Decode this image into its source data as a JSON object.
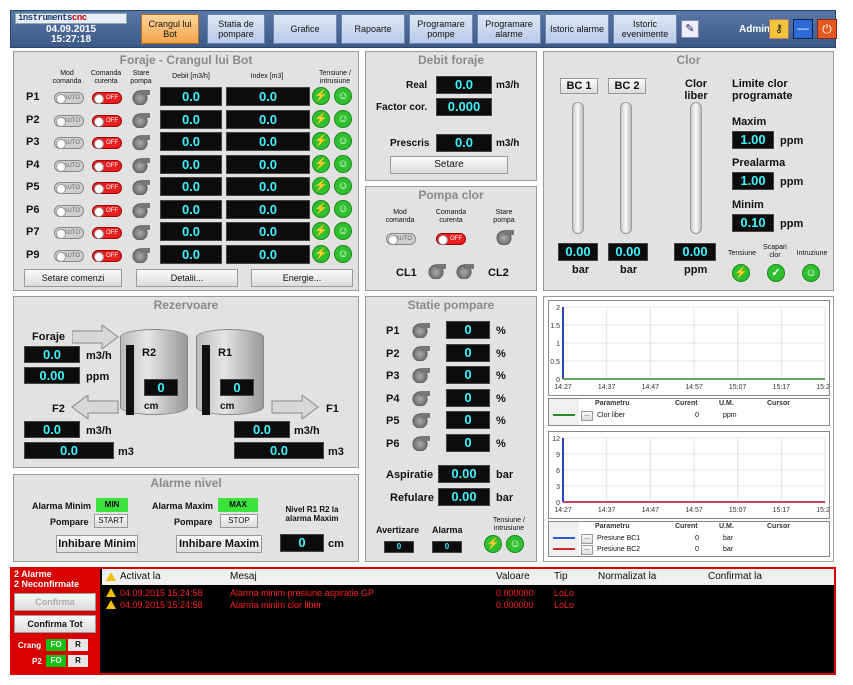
{
  "topbar": {
    "logo_a": "instruments",
    "logo_b": "cnc",
    "date": "04.09.2015",
    "time": "15:27:18",
    "user": "Admin",
    "nav": [
      "Crangul lui Bot",
      "Statia de pompare",
      "Grafice",
      "Rapoarte",
      "Programare pompe",
      "Programare alarme",
      "Istoric alarme",
      "Istoric evenimente"
    ]
  },
  "foraje": {
    "title": "Foraje - Crangul lui Bot",
    "h_mod": "Mod comanda",
    "h_cmd": "Comanda curenta",
    "h_stare": "Stare pompa",
    "h_debit": "Debit [m3/h]",
    "h_index": "Index [m3]",
    "h_tens": "Tensiune / intrusiune",
    "rows": [
      {
        "id": "P1",
        "mode": "AUTO",
        "cmd": "OFF",
        "debit": "0.0",
        "index": "0.0"
      },
      {
        "id": "P2",
        "mode": "AUTO",
        "cmd": "OFF",
        "debit": "0.0",
        "index": "0.0"
      },
      {
        "id": "P3",
        "mode": "AUTO",
        "cmd": "OFF",
        "debit": "0.0",
        "index": "0.0"
      },
      {
        "id": "P4",
        "mode": "AUTO",
        "cmd": "OFF",
        "debit": "0.0",
        "index": "0.0"
      },
      {
        "id": "P5",
        "mode": "AUTO",
        "cmd": "OFF",
        "debit": "0.0",
        "index": "0.0"
      },
      {
        "id": "P6",
        "mode": "AUTO",
        "cmd": "OFF",
        "debit": "0.0",
        "index": "0.0"
      },
      {
        "id": "P7",
        "mode": "AUTO",
        "cmd": "OFF",
        "debit": "0.0",
        "index": "0.0"
      },
      {
        "id": "P9",
        "mode": "AUTO",
        "cmd": "OFF",
        "debit": "0.0",
        "index": "0.0"
      }
    ],
    "btn_setare": "Setare comenzi",
    "btn_detalii": "Detalii...",
    "btn_energie": "Energie..."
  },
  "debit": {
    "title": "Debit foraje",
    "real_label": "Real",
    "real": "0.0",
    "real_unit": "m3/h",
    "factor_label": "Factor cor.",
    "factor": "0.000",
    "prescris_label": "Prescris",
    "prescris": "0.0",
    "prescris_unit": "m3/h",
    "btn": "Setare"
  },
  "pompa_clor": {
    "title": "Pompa clor",
    "h_mod": "Mod comanda",
    "h_cmd": "Comanda curenta",
    "h_stare": "Stare pompa",
    "mode": "AUTO",
    "cmd": "OFF",
    "cl1": "CL1",
    "cl2": "CL2"
  },
  "clor": {
    "title": "Clor",
    "bc1": "BC 1",
    "bc2": "BC 2",
    "liber": "Clor liber",
    "bc1_val": "0.00",
    "bc2_val": "0.00",
    "liber_val": "0.00",
    "unit_bar": "bar",
    "unit_ppm": "ppm",
    "lim_title": "Limite clor programate",
    "maxim_label": "Maxim",
    "maxim": "1.00",
    "prealarma_label": "Prealarma",
    "prealarma": "1.00",
    "minim_label": "Minim",
    "minim": "0.10",
    "tens": "Tensiune",
    "scapari": "Scapari clor",
    "intruz": "Intruziune"
  },
  "rezervoare": {
    "title": "Rezervoare",
    "foraje": "Foraje",
    "foraje_flow": "0.0",
    "flow_unit": "m3/h",
    "foraje_ppm": "0.00",
    "ppm": "ppm",
    "r2": "R2",
    "r1": "R1",
    "r2_val": "0",
    "r1_val": "0",
    "cm": "cm",
    "f2": "F2",
    "f1": "F1",
    "f2_flow": "0.0",
    "f2_vol": "0.0",
    "f1_flow": "0.0",
    "f1_vol": "0.0",
    "m3": "m3"
  },
  "alarme_nivel": {
    "title": "Alarme nivel",
    "min_label": "Alarma Minim",
    "min_state": "MIN",
    "max_label": "Alarma Maxim",
    "max_state": "MAX",
    "pompare": "Pompare",
    "start": "START",
    "stop": "STOP",
    "nivel_label": "Nivel R1 R2 la alarma Maxim",
    "nivel": "0",
    "cm": "cm",
    "btn_min": "Inhibare Minim",
    "btn_max": "Inhibare Maxim"
  },
  "statie": {
    "title": "Statie pompare",
    "rows": [
      {
        "id": "P1",
        "val": "0"
      },
      {
        "id": "P2",
        "val": "0"
      },
      {
        "id": "P3",
        "val": "0"
      },
      {
        "id": "P4",
        "val": "0"
      },
      {
        "id": "P5",
        "val": "0"
      },
      {
        "id": "P6",
        "val": "0"
      }
    ],
    "pct": "%",
    "asp_label": "Aspiratie",
    "asp": "0.00",
    "ref_label": "Refulare",
    "ref": "0.00",
    "bar": "bar",
    "avert": "Avertizare",
    "alarma": "Alarma",
    "avert_val": "0",
    "alarma_val": "0",
    "tens": "Tensiune / intrusiune"
  },
  "chart_data": [
    {
      "type": "line",
      "y_ticks": [
        "2",
        "1.5",
        "1",
        "0.5",
        "0"
      ],
      "x_ticks": [
        "14:27",
        "14:37",
        "14:47",
        "14:57",
        "15:07",
        "15:17",
        "15:27"
      ],
      "ylim": [
        0,
        2
      ],
      "legend_headers": [
        "Parametru",
        "Curent",
        "U.M.",
        "Cursor"
      ],
      "series": [
        {
          "name": "Clor liber",
          "current": "0",
          "unit": "ppm",
          "values": [
            0,
            0,
            0,
            0,
            0,
            0,
            0
          ],
          "color": "#2a8a2a"
        }
      ]
    },
    {
      "type": "line",
      "y_ticks": [
        "12",
        "9",
        "6",
        "3",
        "0"
      ],
      "x_ticks": [
        "14:27",
        "14:37",
        "14:47",
        "14:57",
        "15:07",
        "15:17",
        "15:27"
      ],
      "ylim": [
        0,
        12
      ],
      "legend_headers": [
        "Parametru",
        "Curent",
        "U.M.",
        "Cursor"
      ],
      "series": [
        {
          "name": "Presiune BC1",
          "current": "0",
          "unit": "bar",
          "values": [
            0,
            0,
            0,
            0,
            0,
            0,
            0
          ],
          "color": "#2a5ad0"
        },
        {
          "name": "Presiune BC2",
          "current": "0",
          "unit": "bar",
          "values": [
            0,
            0,
            0,
            0,
            0,
            0,
            0
          ],
          "color": "#d02a2a"
        }
      ]
    }
  ],
  "alarms": {
    "count_alarm": "2 Alarme",
    "count_unconf": "2 Neconfirmate",
    "btn_confirm": "Confirma",
    "btn_confirm_all": "Confirma Tot",
    "crang": "Crang",
    "p2": "P2",
    "fo": "FO",
    "r": "R",
    "headers": [
      "Activat la",
      "Mesaj",
      "Valoare",
      "Tip",
      "Normalizat la",
      "Confirmat la"
    ],
    "rows": [
      {
        "time": "04.09.2015 15:24:58",
        "msg": "Alarma minim presiune aspiratie GP",
        "val": "0.000000",
        "tip": "LoLo"
      },
      {
        "time": "04.09.2015 15:24:58",
        "msg": "Alarma minim clor liber",
        "val": "0.000000",
        "tip": "LoLo"
      }
    ]
  }
}
